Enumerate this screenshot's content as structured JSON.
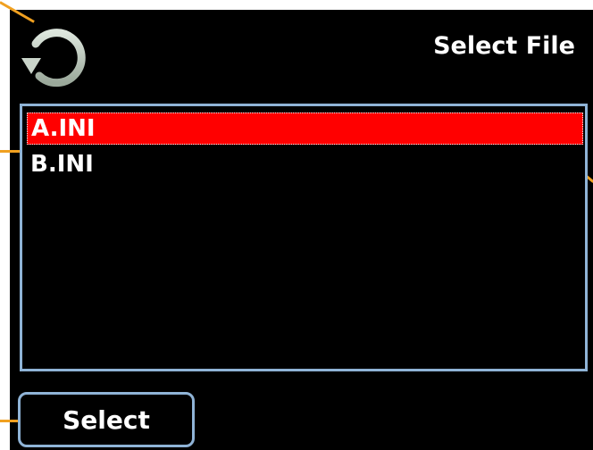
{
  "header": {
    "title": "Select File",
    "back_icon": "circular-arrow-back-icon"
  },
  "file_list": {
    "items": [
      {
        "label": "A.INI",
        "selected": true
      },
      {
        "label": "B.INI",
        "selected": false
      }
    ]
  },
  "footer": {
    "select_label": "Select"
  },
  "colors": {
    "screen_background": "#000000",
    "selection": "#ff0000",
    "frame_border": "#8fb3d6",
    "callout_line": "#f0a020",
    "text": "#ffffff"
  }
}
